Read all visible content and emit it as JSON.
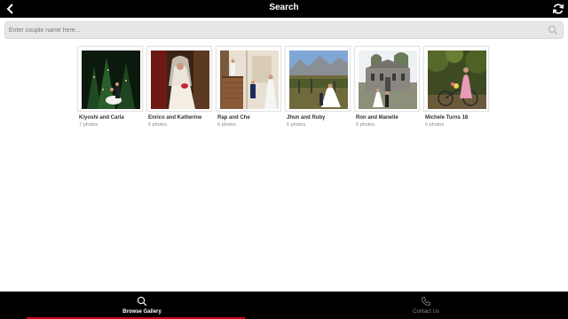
{
  "header": {
    "title": "Search",
    "back_icon": "chevron-left-icon",
    "refresh_icon": "refresh-icon"
  },
  "search": {
    "placeholder": "Enter couple name here...",
    "value": "",
    "icon": "search-icon"
  },
  "galleries": [
    {
      "name": "Kiyoshi and Carla",
      "count": "7 photos"
    },
    {
      "name": "Enrico and Katherine",
      "count": "6 photos"
    },
    {
      "name": "Rap and Che",
      "count": "6 photos"
    },
    {
      "name": "Jhun and Ruby",
      "count": "5 photos"
    },
    {
      "name": "Ron and Manelle",
      "count": "6 photos"
    },
    {
      "name": "Michele Turns 18",
      "count": "0 photos"
    }
  ],
  "tabbar": {
    "browse_label": "Browse Gallery",
    "contact_label": "Contact Us",
    "accent_color": "#d0021b"
  }
}
